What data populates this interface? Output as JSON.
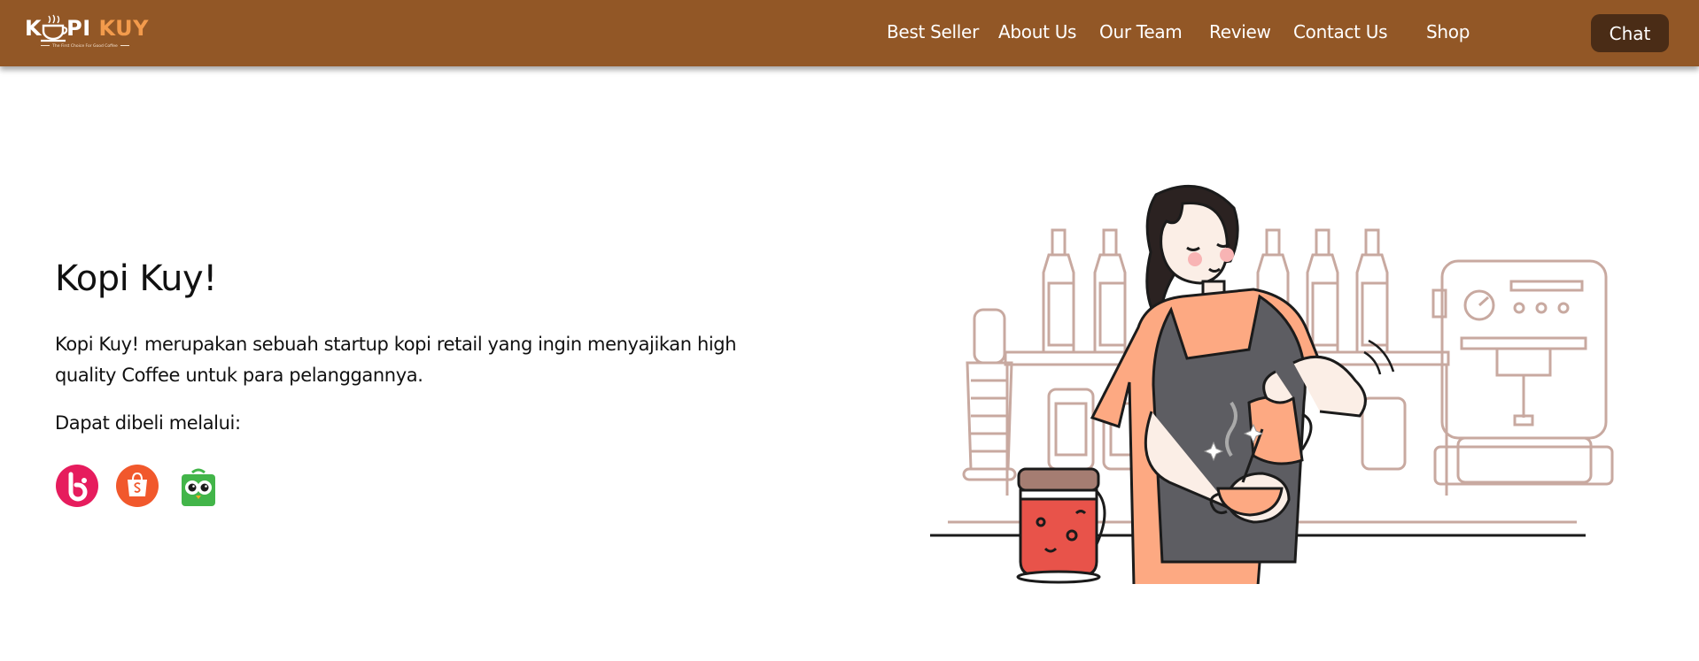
{
  "brand": {
    "name_part1": "K",
    "name_part2": "PI",
    "name_part3": "KUY",
    "tagline": "The First Choice For Good Coffee",
    "colors": {
      "navbar": "#925726",
      "accent": "#f39b4c",
      "chat_button": "#4a2c16"
    }
  },
  "nav": {
    "links": [
      {
        "label": "Best Seller"
      },
      {
        "label": "About Us"
      },
      {
        "label": "Our Team"
      },
      {
        "label": "Review"
      },
      {
        "label": "Contact Us"
      },
      {
        "label": "Shop"
      }
    ],
    "chat_label": "Chat"
  },
  "hero": {
    "title": "Kopi Kuy!",
    "description": "Kopi Kuy! merupakan sebuah startup kopi retail yang ingin menyajikan high quality Coffee untuk para pelanggannya.",
    "subtitle": "Dapat dibeli melalui:",
    "stores": [
      {
        "icon": "blibli-icon",
        "color": "#e61c5d"
      },
      {
        "icon": "shopee-icon",
        "color": "#f1582c"
      },
      {
        "icon": "tokopedia-icon",
        "color": "#42b549"
      }
    ]
  }
}
